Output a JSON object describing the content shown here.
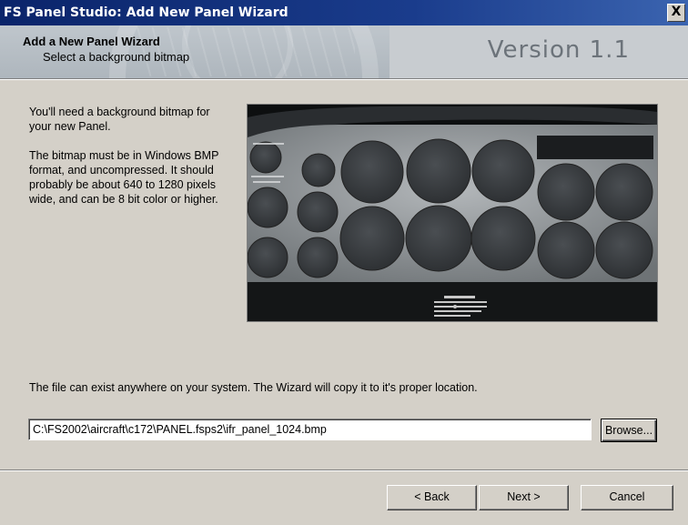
{
  "window": {
    "title": "FS Panel Studio: Add New Panel Wizard",
    "close_glyph": "X"
  },
  "header": {
    "title": "Add a New Panel Wizard",
    "subtitle": "Select a background bitmap",
    "version": "Version 1.1"
  },
  "body": {
    "intro": "You'll need a background bitmap for your new Panel.",
    "requirements": "The bitmap must be in Windows BMP format, and uncompressed. It should probably be about 640 to 1280 pixels wide, and can be 8 bit color or higher.",
    "file_note": "The file can exist anywhere on your system. The Wizard will copy it to it's proper location.",
    "file_path": "C:\\FS2002\\aircraft\\c172\\PANEL.fsps2\\ifr_panel_1024.bmp",
    "browse_label": "Browse...",
    "preview_icon": "panel-preview-image"
  },
  "footer": {
    "back_label": "< Back",
    "next_label": "Next >",
    "cancel_label": "Cancel"
  }
}
